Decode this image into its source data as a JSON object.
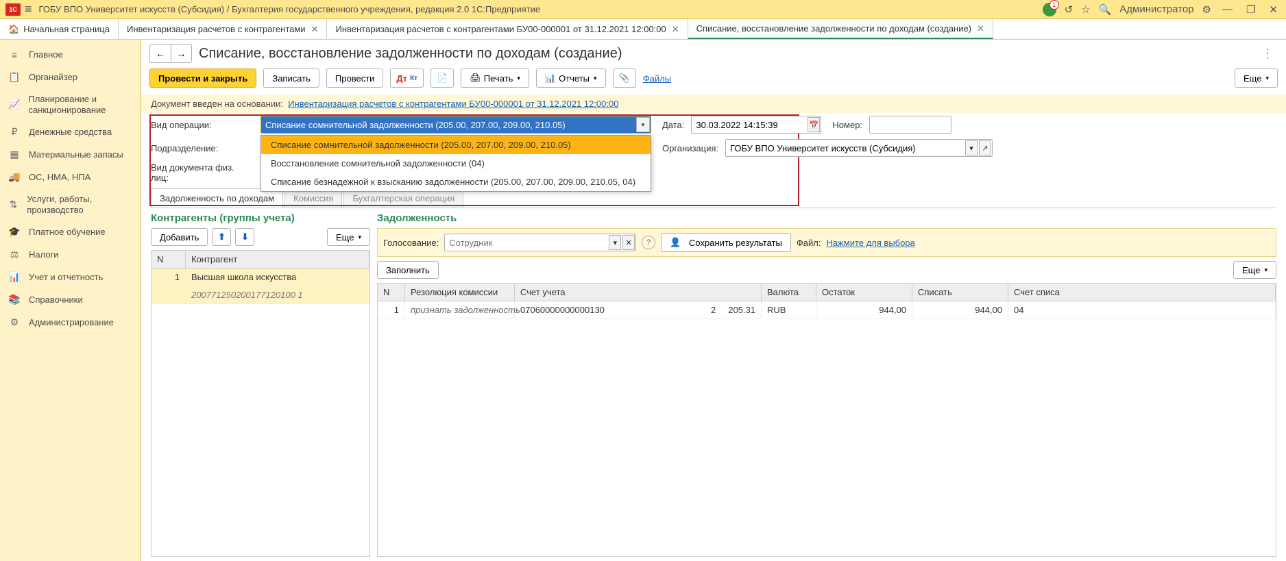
{
  "titlebar": {
    "title": "ГОБУ ВПО Университет искусств (Субсидия) / Бухгалтерия государственного учреждения, редакция 2.0 1С:Предприятие",
    "user": "Администратор"
  },
  "tabs": {
    "home": "Начальная страница",
    "t1": "Инвентаризация расчетов с контрагентами",
    "t2": "Инвентаризация расчетов с контрагентами БУ00-000001 от 31.12.2021 12:00:00",
    "t3": "Списание, восстановление задолженности по доходам (создание)"
  },
  "sidebar": {
    "items": [
      "Главное",
      "Органайзер",
      "Планирование и санкционирование",
      "Денежные средства",
      "Материальные запасы",
      "ОС, НМА, НПА",
      "Услуги, работы, производство",
      "Платное обучение",
      "Налоги",
      "Учет и отчетность",
      "Справочники",
      "Администрирование"
    ]
  },
  "doc": {
    "title": "Списание, восстановление задолженности по доходам (создание)",
    "toolbar": {
      "post_close": "Провести и закрыть",
      "write": "Записать",
      "post": "Провести",
      "print": "Печать",
      "reports": "Отчеты",
      "files": "Файлы",
      "more": "Еще"
    },
    "basis_label": "Документ введен на основании:",
    "basis_link": "Инвентаризация расчетов с контрагентами БУ00-000001 от 31.12.2021 12:00:00",
    "fields": {
      "op_type_label": "Вид операции:",
      "op_type_value": "Списание сомнительной задолженности (205.00, 207.00, 209.00, 210.05)",
      "date_label": "Дата:",
      "date_value": "30.03.2022 14:15:39",
      "number_label": "Номер:",
      "subdiv_label": "Подразделение:",
      "org_label": "Организация:",
      "org_value": "ГОБУ ВПО Университет искусств (Субсидия)",
      "doc_fiz_label": "Вид документа физ. лиц:"
    },
    "op_options": [
      "Списание сомнительной задолженности (205.00, 207.00, 209.00, 210.05)",
      "Восстановление сомнительной задолженности (04)",
      "Списание безнадежной к взысканию задолженности (205.00, 207.00, 209.00, 210.05, 04)"
    ],
    "inner_tabs": {
      "t1": "Задолженность по доходам",
      "t2": "Комиссия",
      "t3": "Бухгалтерская операция"
    }
  },
  "left_panel": {
    "title": "Контрагенты (группы учета)",
    "add": "Добавить",
    "more": "Еще",
    "cols": {
      "n": "N",
      "name": "Контрагент"
    },
    "row": {
      "n": "1",
      "name": "Высшая школа искусства",
      "sub": "200771250200177120100 1"
    }
  },
  "right_panel": {
    "title": "Задолженность",
    "vote_label": "Голосование:",
    "vote_placeholder": "Сотрудник",
    "save_results": "Сохранить результаты",
    "file_label": "Файл:",
    "file_link": "Нажмите для выбора",
    "fill": "Заполнить",
    "more": "Еще",
    "cols": {
      "n": "N",
      "res": "Резолюция комиссии",
      "acc": "Счет учета",
      "cur": "Валюта",
      "rest": "Остаток",
      "wr": "Списать",
      "acc2": "Счет списа"
    },
    "row": {
      "n": "1",
      "res": "признать задолженность ...",
      "acc_code": "07060000000000130",
      "acc_sub": "2",
      "acc_num": "205.31",
      "cur": "RUB",
      "rest": "944,00",
      "wr": "944,00",
      "acc2": "04"
    }
  }
}
